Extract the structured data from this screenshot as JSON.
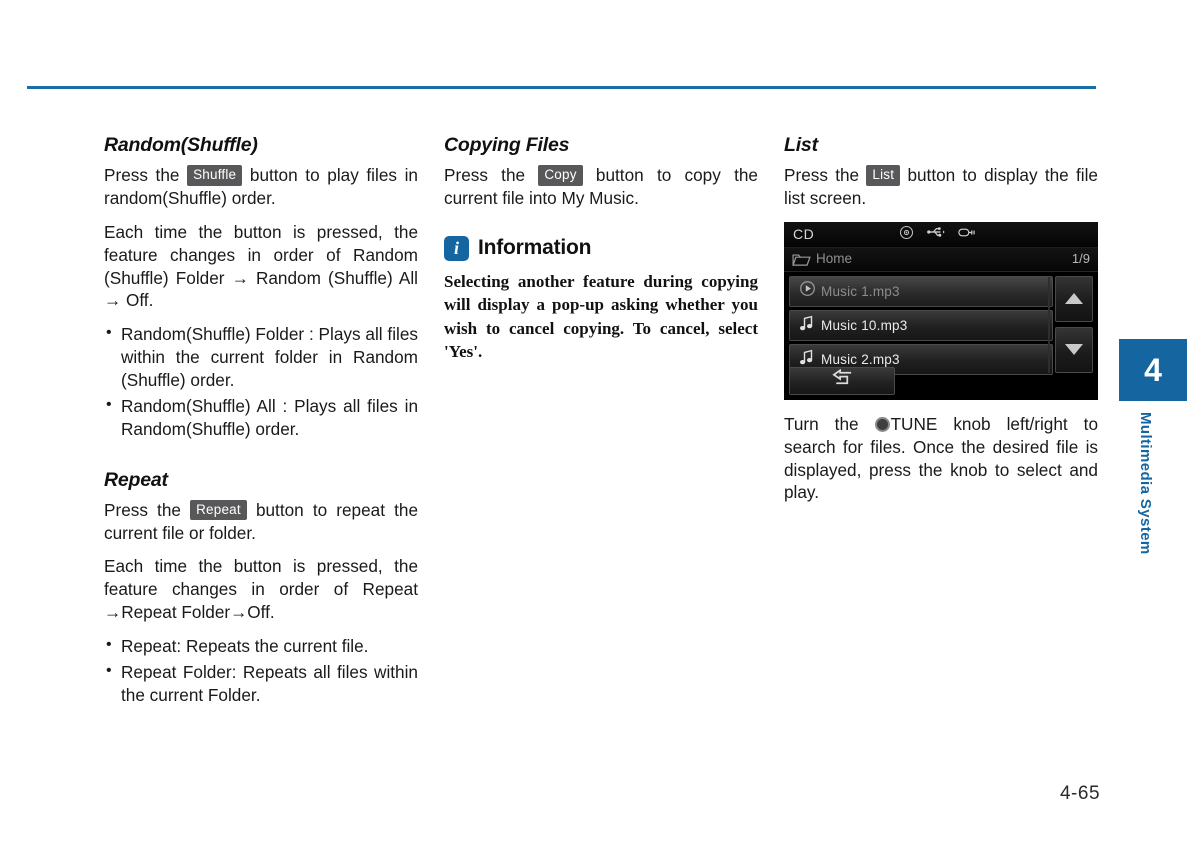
{
  "page": {
    "number": "4-65",
    "chapter_number": "4",
    "chapter_label": "Multimedia System",
    "accent_color": "#1565a0",
    "rule_color": "#1b6ea5"
  },
  "col1": {
    "random": {
      "title": "Random(Shuffle)",
      "p1_before": "Press the",
      "p1_chip": "Shuffle",
      "p1_after": "button to play files in random(Shuffle) order.",
      "p2": "Each time the button is pressed, the feature changes in order of Random (Shuffle) Folder → Random (Shuffle) All → Off.",
      "bullets": [
        "Random(Shuffle) Folder : Plays all files within the current folder in Random (Shuffle) order.",
        "Random(Shuffle) All : Plays all files in Random(Shuffle) order."
      ]
    },
    "repeat": {
      "title": "Repeat",
      "p1_before": "Press the",
      "p1_chip": "Repeat",
      "p1_after": "button to repeat the current file or folder.",
      "p2": "Each time the button is pressed, the feature changes in order of Repeat →Repeat Folder→Off.",
      "bullets": [
        "Repeat: Repeats the current file.",
        "Repeat Folder: Repeats all files within the current Folder."
      ]
    }
  },
  "col2": {
    "copying": {
      "title": "Copying Files",
      "p1_before": "Press the",
      "p1_chip": "Copy",
      "p1_after": "button to copy the current file into My Music."
    },
    "information": {
      "icon": "info-icon",
      "icon_glyph": "i",
      "title": "Information",
      "body": "Selecting another feature during copying will display a pop-up asking whether you wish to cancel copying. To cancel, select 'Yes'."
    }
  },
  "col3": {
    "list": {
      "title": "List",
      "p1_before": "Press the",
      "p1_chip": "List",
      "p1_after": "button to display the file list screen."
    },
    "tune_note_before": "Turn the",
    "tune_note_knob": "knob-icon",
    "tune_note_after": "TUNE knob left/right to search for files. Once the desired file is displayed, press the knob to select and play."
  },
  "head_unit": {
    "source_label": "CD",
    "status_icons": [
      "disc-icon",
      "usb-icon",
      "aux-jack-icon"
    ],
    "breadcrumb": {
      "folder_icon": "folder-icon",
      "label": "Home",
      "page_indicator": "1/9"
    },
    "rows": [
      {
        "icon": "play-circle-icon",
        "label": "Music 1.mp3",
        "playing": true
      },
      {
        "icon": "music-note-icon",
        "label": "Music 10.mp3",
        "playing": false
      },
      {
        "icon": "music-note-icon",
        "label": "Music 2.mp3",
        "playing": false
      }
    ],
    "scroll_up_icon": "arrow-up-icon",
    "scroll_down_icon": "arrow-down-icon",
    "back_icon": "back-arrow-icon"
  }
}
